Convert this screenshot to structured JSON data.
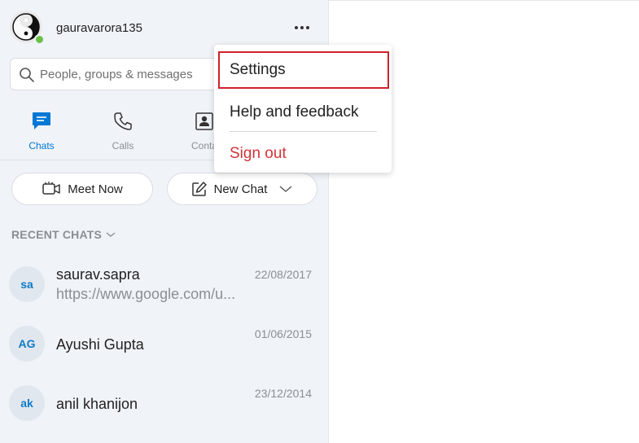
{
  "header": {
    "username": "gauravarora135",
    "more_icon": "more-dots-icon"
  },
  "search": {
    "placeholder": "People, groups & messages",
    "value": ""
  },
  "nav": {
    "tabs": [
      {
        "label": "Chats",
        "icon": "chat-icon",
        "active": true
      },
      {
        "label": "Calls",
        "icon": "phone-icon",
        "active": false
      },
      {
        "label": "Conta",
        "icon": "contacts-icon",
        "active": false
      }
    ]
  },
  "actions": {
    "meet_now": "Meet Now",
    "new_chat": "New Chat"
  },
  "recent": {
    "heading": "RECENT CHATS",
    "chats": [
      {
        "initials": "sa",
        "name": "saurav.sapra",
        "preview": "https://www.google.com/u...",
        "date": "22/08/2017"
      },
      {
        "initials": "AG",
        "name": "Ayushi Gupta",
        "preview": "",
        "date": "01/06/2015"
      },
      {
        "initials": "ak",
        "name": "anil khanijon",
        "preview": "",
        "date": "23/12/2014"
      }
    ]
  },
  "menu": {
    "items": [
      {
        "label": "Settings",
        "selected": true
      },
      {
        "label": "Help and feedback",
        "selected": false
      },
      {
        "label": "Sign out",
        "selected": false
      }
    ]
  },
  "colors": {
    "accent": "#0078d4",
    "presence": "#6cc04a",
    "highlight_border": "#d0202a",
    "sign_out": "#d13438"
  }
}
